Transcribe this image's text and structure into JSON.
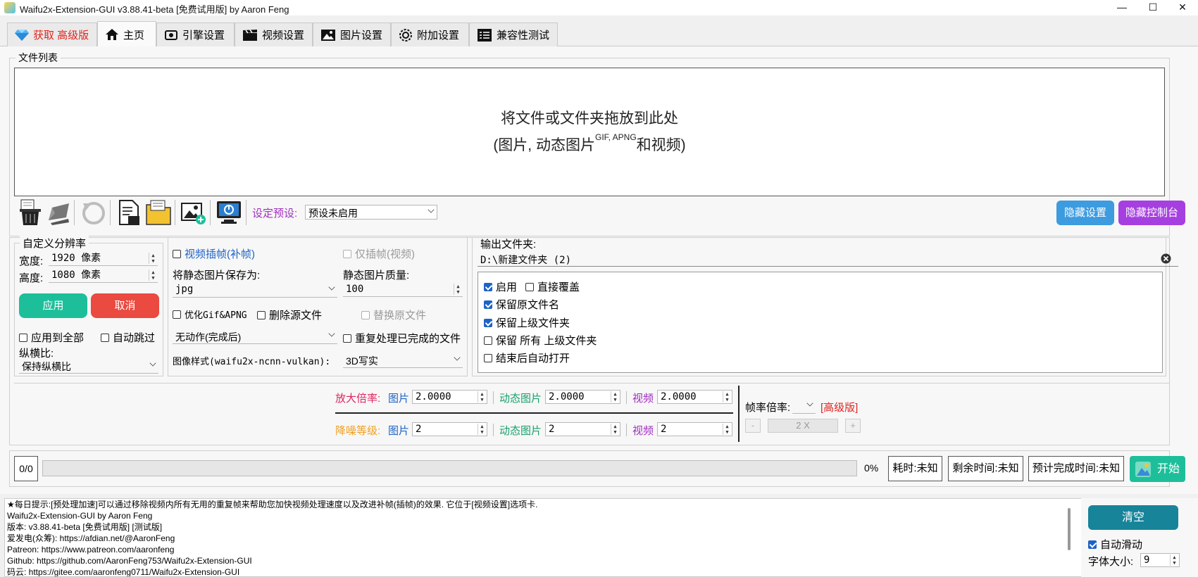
{
  "window": {
    "title": "Waifu2x-Extension-GUI v3.88.41-beta [免费试用版] by Aaron Feng",
    "minimize": "—",
    "maximize": "☐",
    "close": "✕"
  },
  "tabs": [
    {
      "label": "获取  高级版",
      "icon": "diamond-icon",
      "color": "#e0241f"
    },
    {
      "label": "主页",
      "icon": "home-icon",
      "active": true
    },
    {
      "label": "引擎设置",
      "icon": "engine-icon"
    },
    {
      "label": "视频设置",
      "icon": "clapperboard-icon"
    },
    {
      "label": "图片设置",
      "icon": "image-icon"
    },
    {
      "label": "附加设置",
      "icon": "gear-icon"
    },
    {
      "label": "兼容性测试",
      "icon": "checklist-icon"
    }
  ],
  "file_list": {
    "title": "文件列表",
    "drop_line1": "将文件或文件夹拖放到此处",
    "drop_line2_pre": "(图片, 动态图片",
    "drop_line2_sup": "GIF, APNG",
    "drop_line2_post": "和视频)"
  },
  "toolbar": {
    "preset_label": "设定预设:",
    "preset_value": "预设未启用",
    "hide_settings": "隐藏设置",
    "hide_console": "隐藏控制台",
    "icons": [
      "trash-icon",
      "broom-icon",
      "reload-icon",
      "clipboard-file-icon",
      "folder-icon",
      "add-image-icon",
      "monitor-power-icon"
    ]
  },
  "custom_res": {
    "title": "自定义分辨率",
    "width_label": "宽度:",
    "width_value": "1920 像素",
    "height_label": "高度:",
    "height_value": "1080 像素",
    "apply": "应用",
    "cancel": "取消",
    "apply_all": "应用到全部",
    "auto_skip": "自动跳过",
    "aspect_label": "纵横比:",
    "aspect_value": "保持纵横比"
  },
  "middle": {
    "video_interp": "视频插帧(补帧)",
    "interp_only": "仅插帧(视频)",
    "save_as_label": "将静态图片保存为:",
    "save_as_value": "jpg",
    "quality_label": "静态图片质量:",
    "quality_value": "100",
    "optimize_gif": "优化Gif&APNG",
    "delete_source": "删除源文件",
    "replace_original": "替换原文件",
    "after_action": "无动作(完成后)",
    "reprocess": "重复处理已完成的文件",
    "style_label": "图像样式(waifu2x-ncnn-vulkan):",
    "style_value": "3D写实"
  },
  "output": {
    "title": "输出文件夹:",
    "path": "D:\\新建文件夹 (2)",
    "enable": "启用",
    "overwrite": "直接覆盖",
    "keep_name": "保留原文件名",
    "keep_parent": "保留上级文件夹",
    "keep_all_parent": "保留 所有 上级文件夹",
    "auto_open": "结束后自动打开"
  },
  "scale": {
    "scale_label": "放大倍率:",
    "denoise_label": "降噪等级:",
    "image": "图片",
    "gif": "动态图片",
    "video": "视频",
    "scale_image": "2.0000",
    "scale_gif": "2.0000",
    "scale_video": "2.0000",
    "denoise_image": "2",
    "denoise_gif": "2",
    "denoise_video": "2",
    "framerate_label": "帧率倍率:",
    "premium": "[高级版]",
    "minus": "-",
    "plus": "+",
    "framerate_value": "2 X"
  },
  "progress": {
    "count": "0/0",
    "percent": "0%",
    "fraction": 0,
    "elapsed": "耗时:未知",
    "remaining": "剩余时间:未知",
    "eta": "预计完成时间:未知",
    "start": "开始"
  },
  "console": {
    "lines": [
      "★每日提示:[预处理加速]可以通过移除视频内所有无用的重复帧来帮助您加快视频处理速度以及改进补帧(插帧)的效果. 它位于[视频设置]选项卡.",
      "Waifu2x-Extension-GUI by Aaron Feng",
      "版本: v3.88.41-beta [免费试用版] [测试版]",
      "爱发电(众筹): https://afdian.net/@AaronFeng",
      "Patreon: https://www.patreon.com/aaronfeng",
      "Github: https://github.com/AaronFeng753/Waifu2x-Extension-GUI",
      "码云: https://gitee.com/aaronfeng0711/Waifu2x-Extension-GUI"
    ],
    "clear": "清空",
    "auto_scroll": "自动滑动",
    "font_size_label": "字体大小:",
    "font_size_value": "9"
  },
  "colors": {
    "teal": "#1dbf9a",
    "red": "#ea4a3f",
    "blue_btn": "#3d9be0",
    "purple_btn": "#a63fe0",
    "dark_teal": "#17849a",
    "link_blue": "#1e63c6",
    "magenta": "#e0245f",
    "orange": "#f0a020",
    "green": "#18a06a",
    "purple": "#a030c0"
  }
}
